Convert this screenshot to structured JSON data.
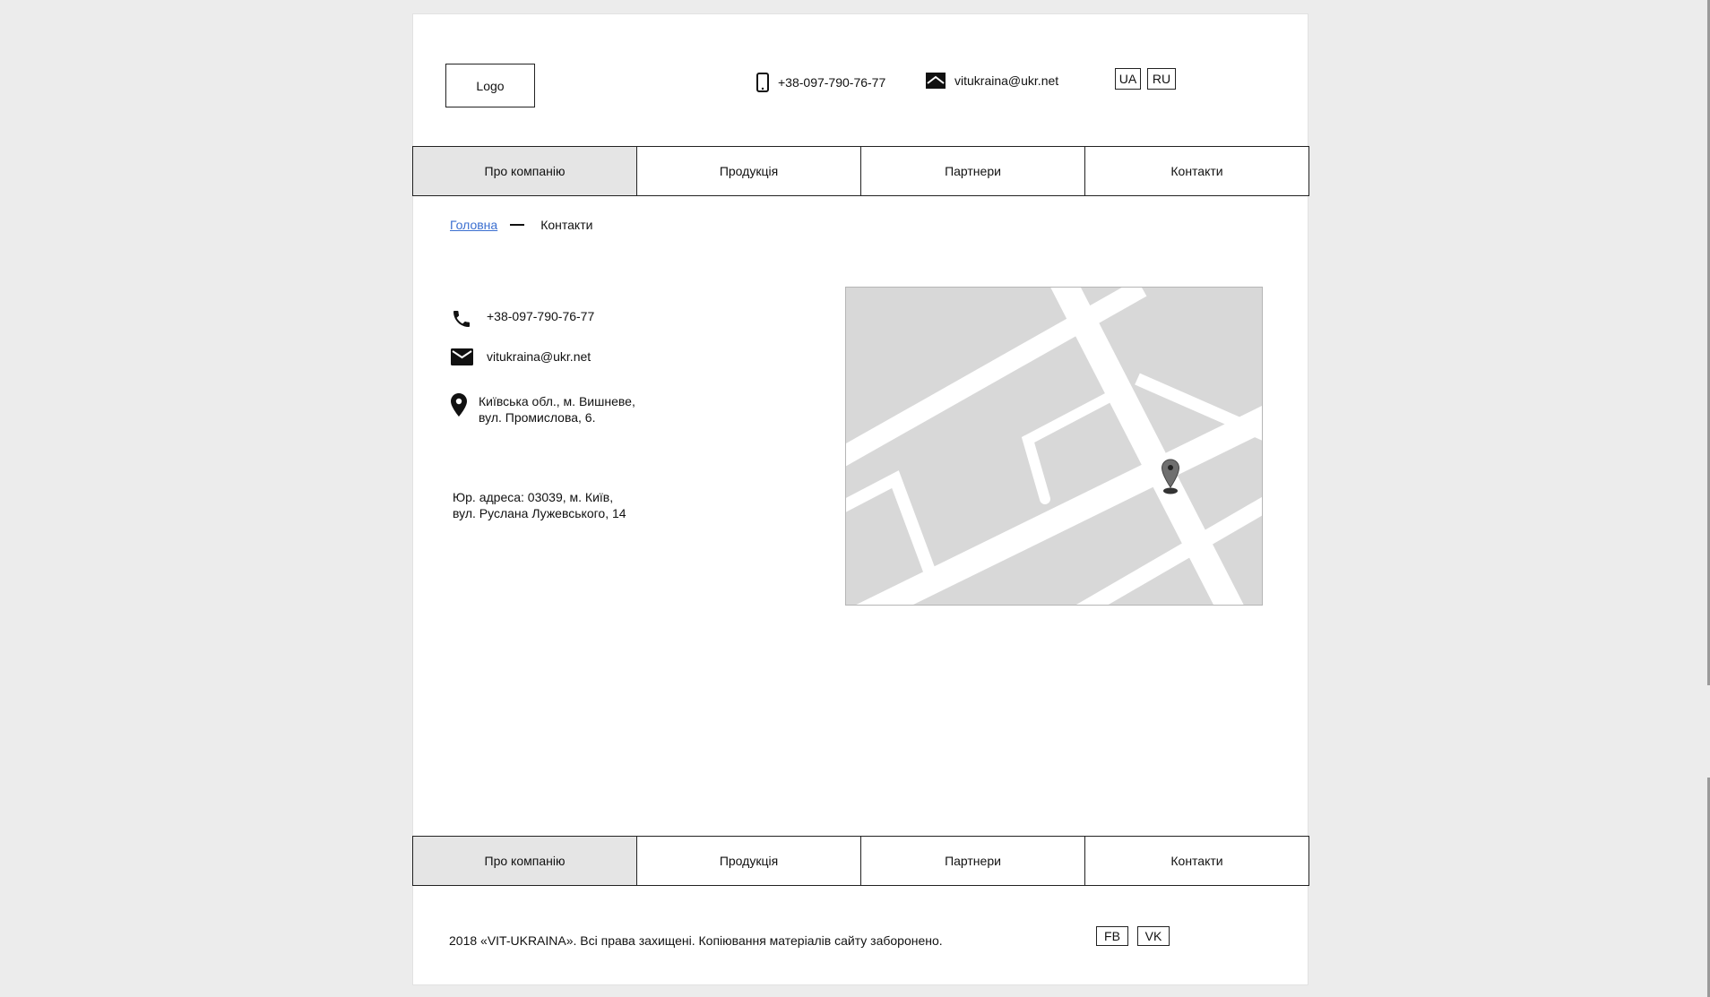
{
  "header": {
    "logo_label": "Logo",
    "phone": "+38-097-790-76-77",
    "email": "vitukraina@ukr.net",
    "languages": [
      "UA",
      "RU"
    ]
  },
  "nav": {
    "items": [
      "Про компанію",
      "Продукція",
      "Партнери",
      "Контакти"
    ],
    "active_index": 0
  },
  "breadcrumb": {
    "home": "Головна",
    "current": "Контакти"
  },
  "contacts": {
    "phone": "+38-097-790-76-77",
    "email": "vitukraina@ukr.net",
    "address_line1": "Київська обл., м. Вишневе,",
    "address_line2": "вул. Промислова, 6.",
    "legal_line1": "Юр. адреса: 03039, м. Київ,",
    "legal_line2": "вул. Руслана Лужевського, 14"
  },
  "icons": {
    "header_phone": "mobile-phone-icon",
    "header_email": "envelope-icon",
    "phone": "phone-handset-icon",
    "email": "mail-icon",
    "address": "location-pin-icon",
    "map_marker": "map-marker-icon"
  },
  "footer": {
    "copyright": "2018 «VIT-UKRAINA». Всі права захищені. Копіювання матеріалів сайту заборонено.",
    "social": [
      "FB",
      "VK"
    ]
  },
  "colors": {
    "link": "#3b6fd0",
    "active_nav": "#e5e5e5",
    "map_bg": "#d8d8d8"
  }
}
